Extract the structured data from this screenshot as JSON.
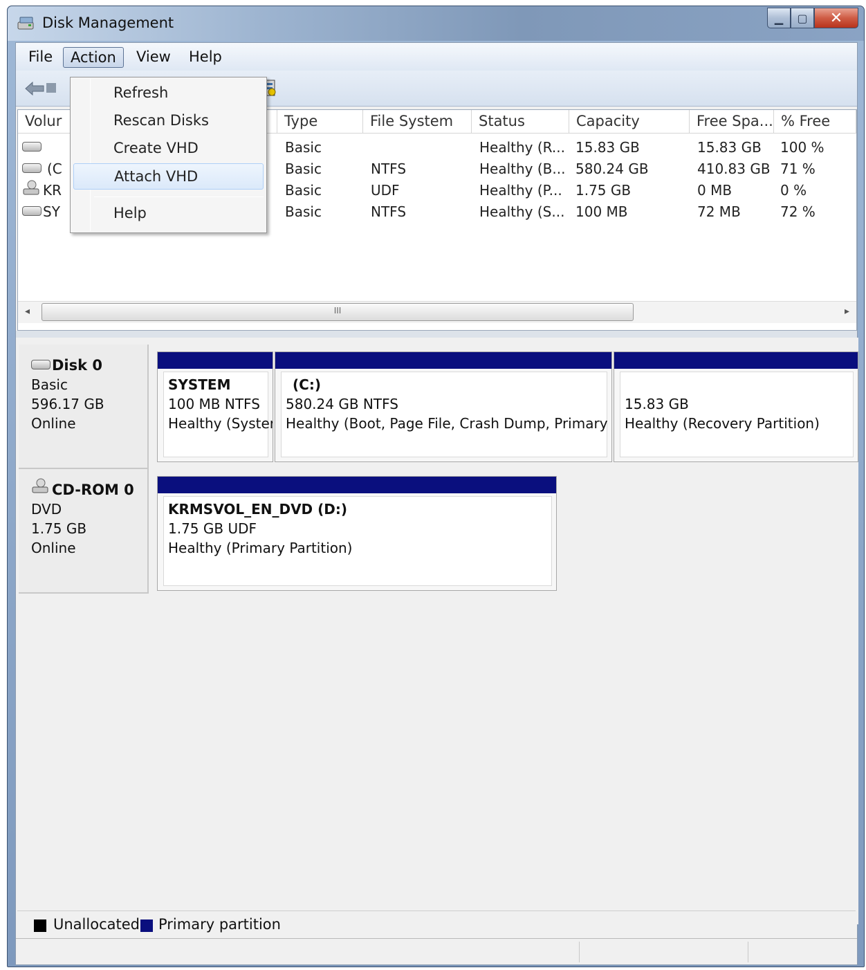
{
  "window": {
    "title": "Disk Management"
  },
  "menubar": {
    "file": "File",
    "action": "Action",
    "view": "View",
    "help": "Help"
  },
  "action_menu": {
    "items": [
      "Refresh",
      "Rescan Disks",
      "Create VHD",
      "Attach VHD",
      "Help"
    ],
    "highlighted": "Attach VHD"
  },
  "volume_list": {
    "headers": [
      "Volur",
      "Type",
      "File System",
      "Status",
      "Capacity",
      "Free Spa...",
      "% Free"
    ],
    "rows": [
      {
        "volume": "",
        "type": "Basic",
        "fs": "",
        "status": "Healthy (R...",
        "capacity": "15.83 GB",
        "free": "15.83 GB",
        "pct": "100 %",
        "icon": "hard-drive-icon"
      },
      {
        "volume": "(C",
        "type": "Basic",
        "fs": "NTFS",
        "status": "Healthy (B...",
        "capacity": "580.24 GB",
        "free": "410.83 GB",
        "pct": "71 %",
        "icon": "hard-drive-icon"
      },
      {
        "volume": "KR",
        "type": "Basic",
        "fs": "UDF",
        "status": "Healthy (P...",
        "capacity": "1.75 GB",
        "free": "0 MB",
        "pct": "0 %",
        "icon": "cd-drive-icon"
      },
      {
        "volume": "SY",
        "type": "Basic",
        "fs": "NTFS",
        "status": "Healthy (S...",
        "capacity": "100 MB",
        "free": "72 MB",
        "pct": "72 %",
        "icon": "hard-drive-icon"
      }
    ],
    "scroll_thumb": "III"
  },
  "disks": [
    {
      "name": "Disk 0",
      "kind": "Basic",
      "size": "596.17 GB",
      "state": "Online",
      "partitions": [
        {
          "title": "SYSTEM",
          "line2": "100 MB NTFS",
          "line3": "Healthy (Syster"
        },
        {
          "title": "(C:)",
          "line2": "580.24 GB NTFS",
          "line3": "Healthy (Boot, Page File, Crash Dump, Primary F"
        },
        {
          "title": "",
          "line2": "15.83 GB",
          "line3": "Healthy (Recovery Partition)"
        }
      ]
    },
    {
      "name": "CD-ROM 0",
      "kind": "DVD",
      "size": "1.75 GB",
      "state": "Online",
      "partitions": [
        {
          "title": "KRMSVOL_EN_DVD  (D:)",
          "line2": "1.75 GB UDF",
          "line3": "Healthy (Primary Partition)"
        }
      ]
    }
  ],
  "legend": {
    "unallocated": "Unallocated",
    "primary": "Primary partition",
    "unallocated_color": "#000000",
    "primary_color": "#0a0f7e"
  }
}
